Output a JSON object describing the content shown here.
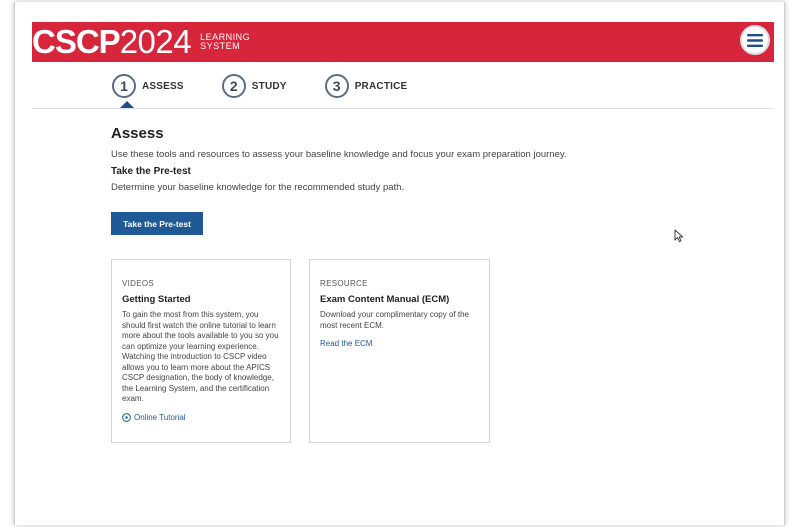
{
  "header": {
    "brand": "CSCP",
    "year": "2024",
    "sub_line1": "LEARNING",
    "sub_line2": "SYSTEM",
    "accent": "#d7263b",
    "menu_icon": "hamburger-icon"
  },
  "steps": [
    {
      "num": "1",
      "label": "ASSESS"
    },
    {
      "num": "2",
      "label": "STUDY"
    },
    {
      "num": "3",
      "label": "PRACTICE"
    }
  ],
  "main": {
    "title": "Assess",
    "intro": "Use these tools and resources to assess your baseline knowledge and focus your exam preparation journey.",
    "subheading": "Take the Pre-test",
    "subtext": "Determine your baseline knowledge for the recommended study path.",
    "cta_label": "Take the Pre-test",
    "cta_color": "#1f5a96"
  },
  "cards": [
    {
      "kicker": "VIDEOS",
      "title": "Getting Started",
      "body": "To gain the most from this system, you should first watch the online tutorial to learn more about the tools available to you so you can optimize your learning experience. Watching the introduction to CSCP video allows you to learn more about the APICS CSCP designation, the body of knowledge, the Learning System, and the certification exam.",
      "link": "Online Tutorial",
      "link_icon": "play-circle-icon"
    },
    {
      "kicker": "RESOURCE",
      "title": "Exam Content Manual (ECM)",
      "body": "Download your complimentary copy of the most recent ECM.",
      "link": "Read the ECM"
    }
  ]
}
